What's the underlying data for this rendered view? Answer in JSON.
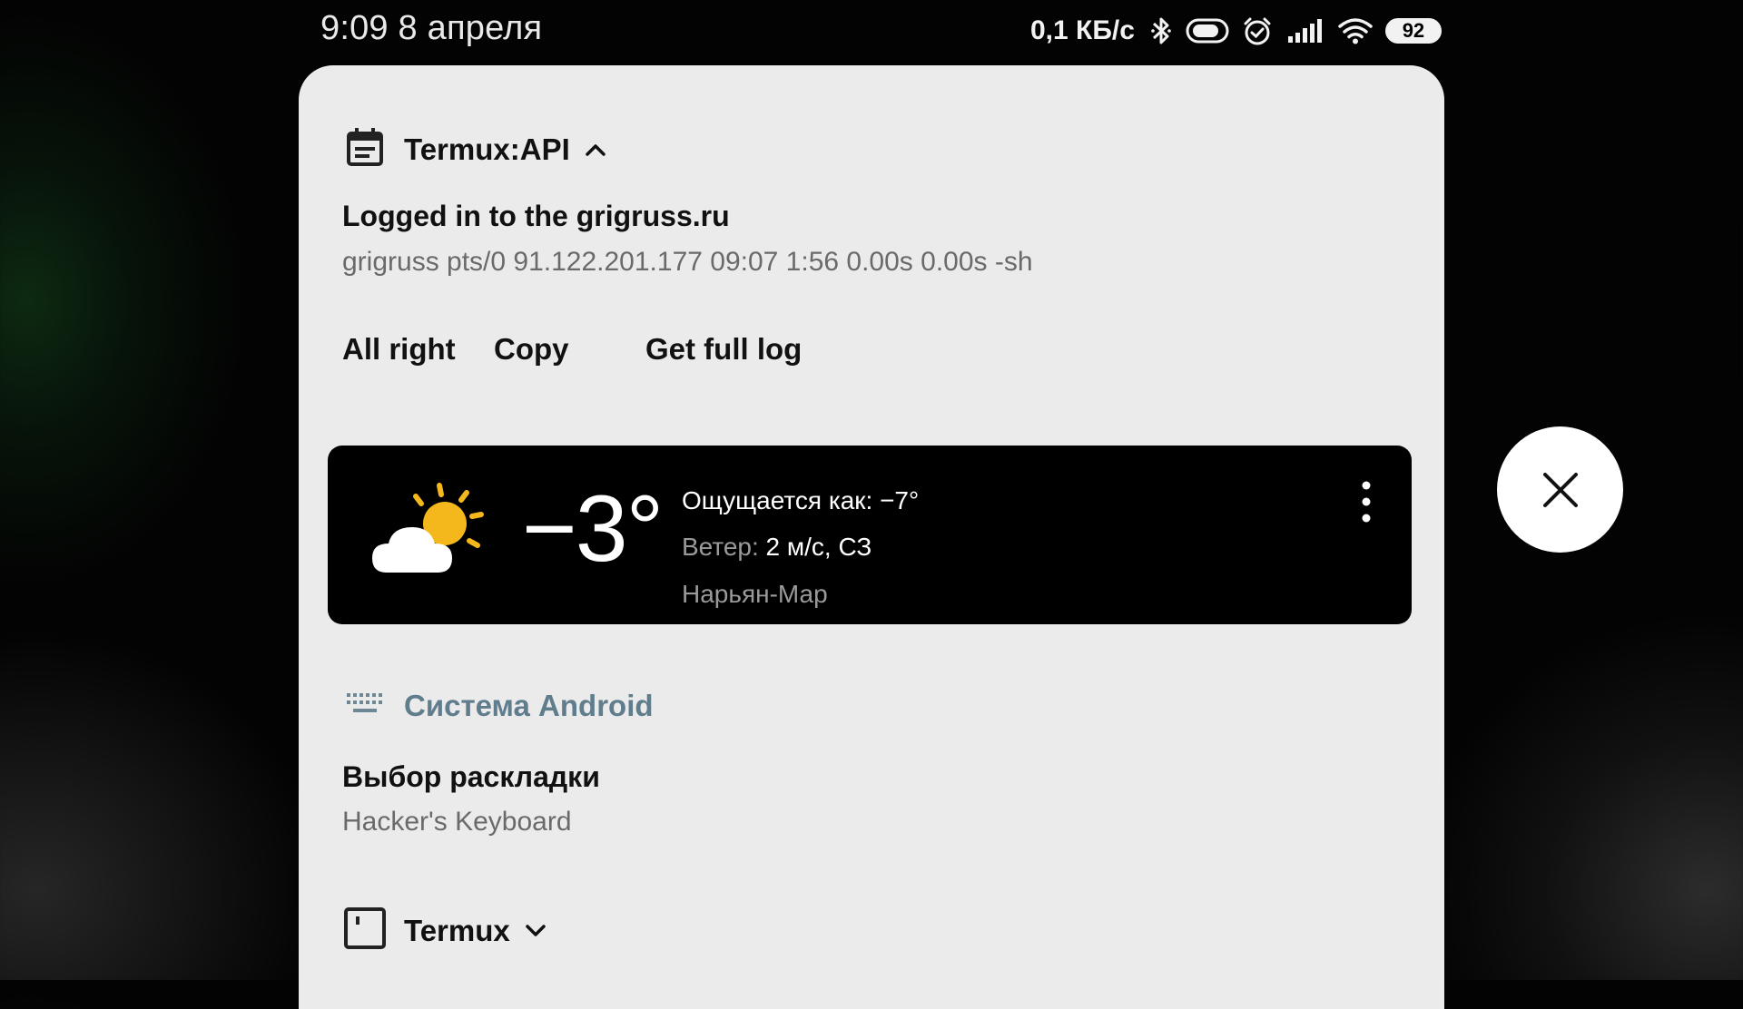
{
  "status_bar": {
    "time": "9:09",
    "date": "8 апреля",
    "net_speed": "0,1 КБ/с",
    "battery": "92",
    "icons": [
      "bluetooth-icon",
      "battery-saver-icon",
      "alarm-icon",
      "signal-icon",
      "wifi-icon"
    ]
  },
  "notifications": {
    "termux_api": {
      "app_name": "Termux:API",
      "title": "Logged in to the grigruss.ru",
      "text": "grigruss pts/0 91.122.201.177 09:07 1:56 0.00s 0.00s -sh",
      "actions": [
        "All right",
        "Copy",
        "Get full log"
      ]
    },
    "weather": {
      "temperature": "−3°",
      "feels_like": "Ощущается как: −7°",
      "wind_label": "Ветер:",
      "wind_value": "2 м/с, СЗ",
      "location": "Нарьян-Мар",
      "icon": "partly-cloudy-icon"
    },
    "android_system": {
      "app_name": "Система Android",
      "title": "Выбор раскладки",
      "text": "Hacker's Keyboard"
    },
    "termux": {
      "app_name": "Termux"
    }
  },
  "colors": {
    "panel_bg": "#ebebeb",
    "weather_bg": "#000000",
    "system_accent": "#5f7d8c",
    "sun": "#f5b81c"
  }
}
